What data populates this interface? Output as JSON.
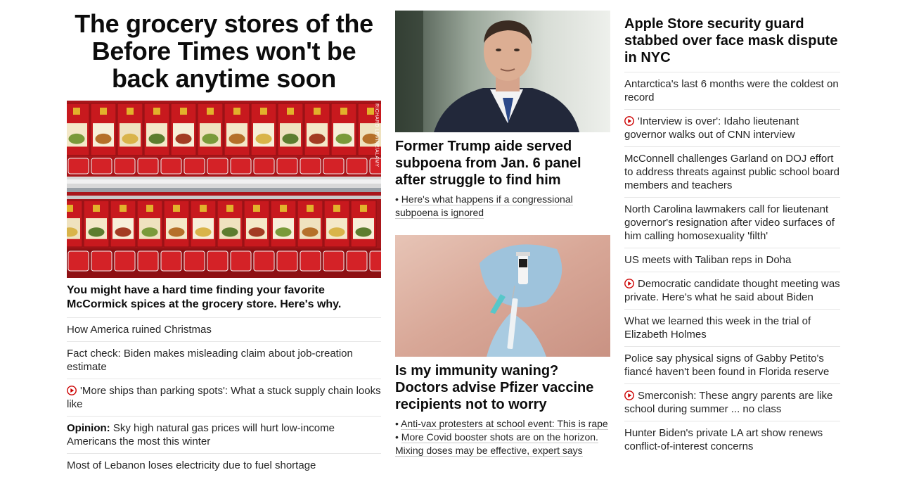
{
  "col1": {
    "headline": "The grocery stores of the Before Times won't be back anytime soon",
    "image_credit": "RICHARD LEVINE/ALAMY",
    "caption": "You might have a hard time finding your favorite McCormick spices at the grocery store. Here's why.",
    "items": [
      {
        "text": "How America ruined Christmas"
      },
      {
        "text": "Fact check: Biden makes misleading claim about job-creation estimate"
      },
      {
        "text": "'More ships than parking spots': What a stuck supply chain looks like",
        "video": true
      },
      {
        "kicker": "Opinion:",
        "text": "Sky high natural gas prices will hurt low-income Americans the most this winter"
      },
      {
        "text": "Most of Lebanon loses electricity due to fuel shortage"
      }
    ]
  },
  "col2": {
    "card1": {
      "title": "Former Trump aide served subpoena from Jan. 6 panel after struggle to find him",
      "links": [
        "Here's what happens if a congressional subpoena is ignored"
      ]
    },
    "card2": {
      "title": "Is my immunity waning? Doctors advise Pfizer vaccine recipients not to worry",
      "links": [
        "Anti-vax protesters at school event: This is rape",
        "More Covid booster shots are on the horizon. Mixing doses may be effective, expert says"
      ]
    }
  },
  "col3": {
    "headline": "Apple Store security guard stabbed over face mask dispute in NYC",
    "items": [
      {
        "text": "Antarctica's last 6 months were the coldest on record"
      },
      {
        "text": "'Interview is over': Idaho lieutenant governor walks out of CNN interview",
        "video": true
      },
      {
        "text": "McConnell challenges Garland on DOJ effort to address threats against public school board members and teachers"
      },
      {
        "text": "North Carolina lawmakers call for lieutenant governor's resignation after video surfaces of him calling homosexuality 'filth'"
      },
      {
        "text": "US meets with Taliban reps in Doha"
      },
      {
        "text": "Democratic candidate thought meeting was private. Here's what he said about Biden",
        "video": true
      },
      {
        "text": "What we learned this week in the trial of Elizabeth Holmes"
      },
      {
        "text": "Police say physical signs of Gabby Petito's fiancé haven't been found in Florida reserve"
      },
      {
        "text": "Smerconish: These angry parents are like school during summer ... no class",
        "video": true
      },
      {
        "text": "Hunter Biden's private LA art show renews conflict-of-interest concerns"
      }
    ]
  },
  "colors": {
    "video_red": "#cc0000",
    "text": "#262626",
    "divider": "#e6e6e6"
  }
}
